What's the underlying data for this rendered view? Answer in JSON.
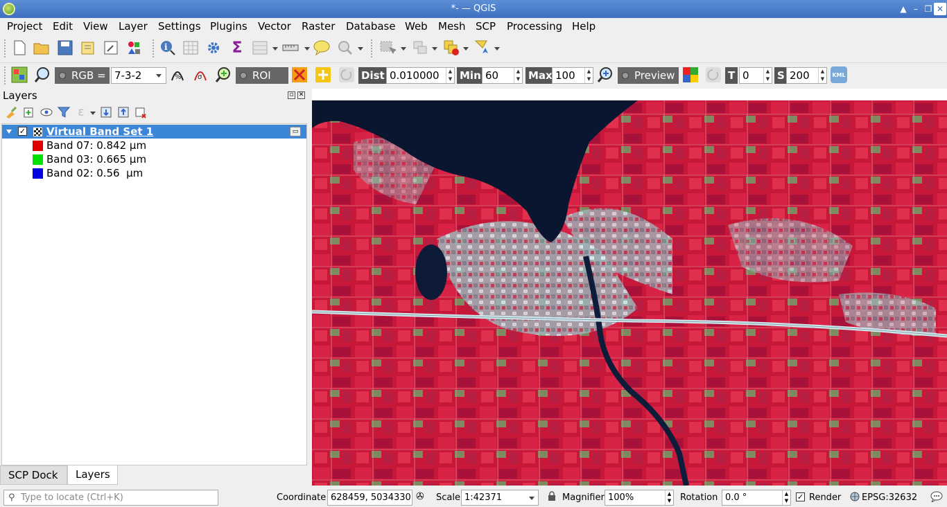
{
  "window": {
    "title": "*- — QGIS"
  },
  "menu": [
    "Project",
    "Edit",
    "View",
    "Layer",
    "Settings",
    "Plugins",
    "Vector",
    "Raster",
    "Database",
    "Web",
    "Mesh",
    "SCP",
    "Processing",
    "Help"
  ],
  "scp_toolbar": {
    "rgb_label": "RGB =",
    "rgb_value": "7-3-2",
    "roi_label": "ROI",
    "dist_label": "Dist",
    "dist_value": "0.010000",
    "min_label": "Min",
    "min_value": "60",
    "max_label": "Max",
    "max_value": "100",
    "preview_label": "Preview",
    "t_label": "T",
    "t_value": "0",
    "s_label": "S",
    "s_value": "200",
    "kml_label": "KML"
  },
  "layers_panel": {
    "title": "Layers",
    "layer": {
      "name": "Virtual Band Set  1",
      "checked": true
    },
    "bands": [
      {
        "label": "Band 07: 0.842 µm",
        "color": "#e00000"
      },
      {
        "label": "Band 03: 0.665 µm",
        "color": "#00e000"
      },
      {
        "label": "Band 02: 0.56  µm",
        "color": "#0000e0"
      }
    ],
    "tabs": [
      "SCP Dock",
      "Layers"
    ]
  },
  "statusbar": {
    "locate_placeholder": "Type to locate (Ctrl+K)",
    "coordinate_label": "Coordinate",
    "coordinate_value": "628459, 5034330",
    "scale_label": "Scale",
    "scale_value": "1:42371",
    "magnifier_label": "Magnifier",
    "magnifier_value": "100%",
    "rotation_label": "Rotation",
    "rotation_value": "0.0 °",
    "render_label": "Render",
    "crs_label": "EPSG:32632"
  },
  "colors": {
    "title_bar": "#3d6fbf",
    "selection": "#3b86d6",
    "map_vegetation": "#c8183a",
    "map_water": "#0a1530"
  }
}
